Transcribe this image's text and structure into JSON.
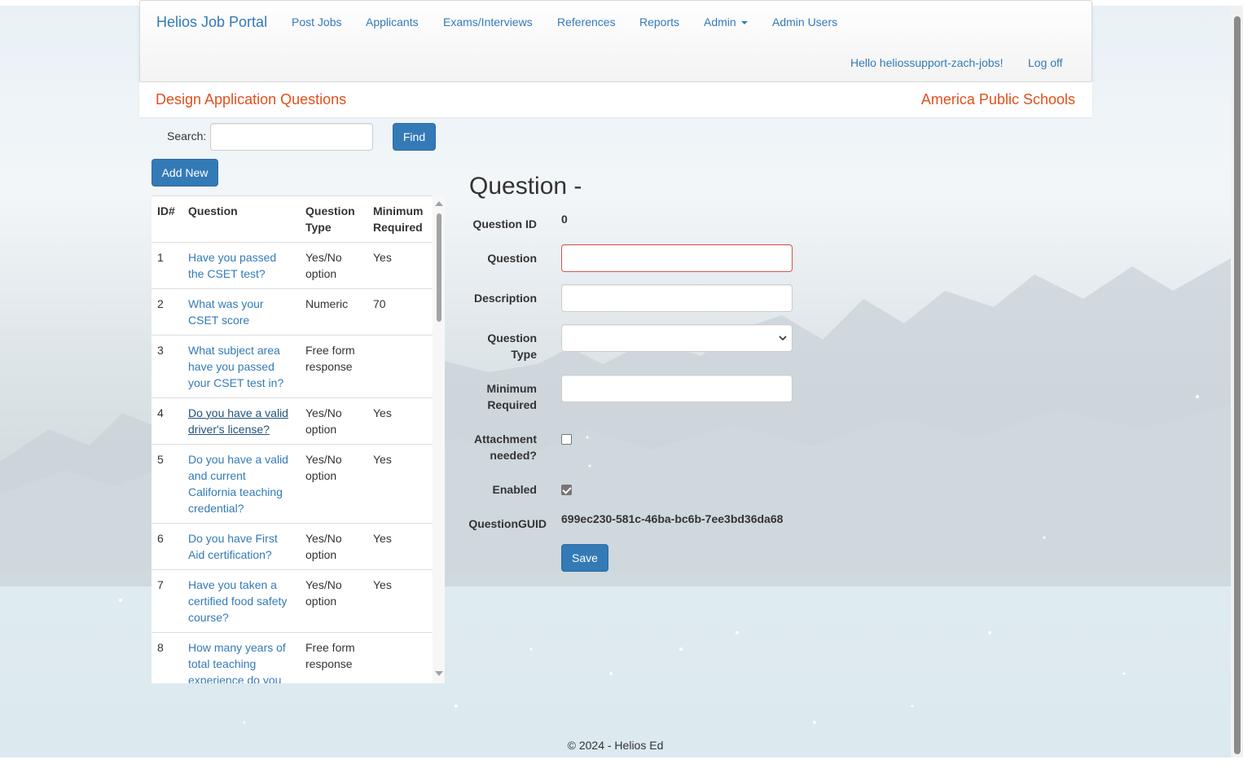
{
  "navbar": {
    "brand": "Helios Job Portal",
    "links": [
      "Post Jobs",
      "Applicants",
      "Exams/Interviews",
      "References",
      "Reports",
      "Admin",
      "Admin Users"
    ],
    "greeting": "Hello heliossupport-zach-jobs!",
    "logoff": "Log off"
  },
  "header": {
    "page_title": "Design Application Questions",
    "org_name": "America Public Schools"
  },
  "search": {
    "label": "Search:",
    "value": "",
    "find_label": "Find"
  },
  "add_new_label": "Add New",
  "table": {
    "headers": {
      "id": "ID#",
      "question": "Question",
      "type_l1": "Question",
      "type_l2": "Type",
      "min_l1": "Minimum",
      "min_l2": "Required"
    },
    "rows": [
      {
        "id": "1",
        "question": "Have you passed the CSET test?",
        "type": "Yes/No option",
        "min": "Yes"
      },
      {
        "id": "2",
        "question": "What was your CSET score",
        "type": "Numeric",
        "min": "70"
      },
      {
        "id": "3",
        "question": "What subject area have you passed your CSET test in?",
        "type": "Free form response",
        "min": ""
      },
      {
        "id": "4",
        "question": "Do you have a valid driver's license?",
        "type": "Yes/No option",
        "min": "Yes"
      },
      {
        "id": "5",
        "question": "Do you have a valid and current California teaching credential?",
        "type": "Yes/No option",
        "min": "Yes"
      },
      {
        "id": "6",
        "question": "Do you have First Aid certification?",
        "type": "Yes/No option",
        "min": "Yes"
      },
      {
        "id": "7",
        "question": "Have you taken a certified food safety course?",
        "type": "Yes/No option",
        "min": "Yes"
      },
      {
        "id": "8",
        "question": "How many years of total teaching experience do you",
        "type": "Free form response",
        "min": ""
      }
    ]
  },
  "form": {
    "heading": "Question -",
    "question_id_label": "Question ID",
    "question_id_value": "0",
    "question_label": "Question",
    "question_value": "",
    "description_label": "Description",
    "description_value": "",
    "type_label_l1": "Question",
    "type_label_l2": "Type",
    "type_value": "",
    "min_label_l1": "Minimum",
    "min_label_l2": "Required",
    "min_value": "",
    "attach_label_l1": "Attachment",
    "attach_label_l2": "needed?",
    "attach_checked": false,
    "enabled_label": "Enabled",
    "enabled_checked": true,
    "guid_label": "QuestionGUID",
    "guid_value": "699ec230-581c-46ba-bc6b-7ee3bd36da68",
    "save_label": "Save"
  },
  "footer": {
    "text": "© 2024 - Helios Ed"
  },
  "colors": {
    "link": "#337ab7",
    "accent_orange": "#e2501c",
    "button": "#337ab7",
    "error_border": "#d9534f"
  }
}
